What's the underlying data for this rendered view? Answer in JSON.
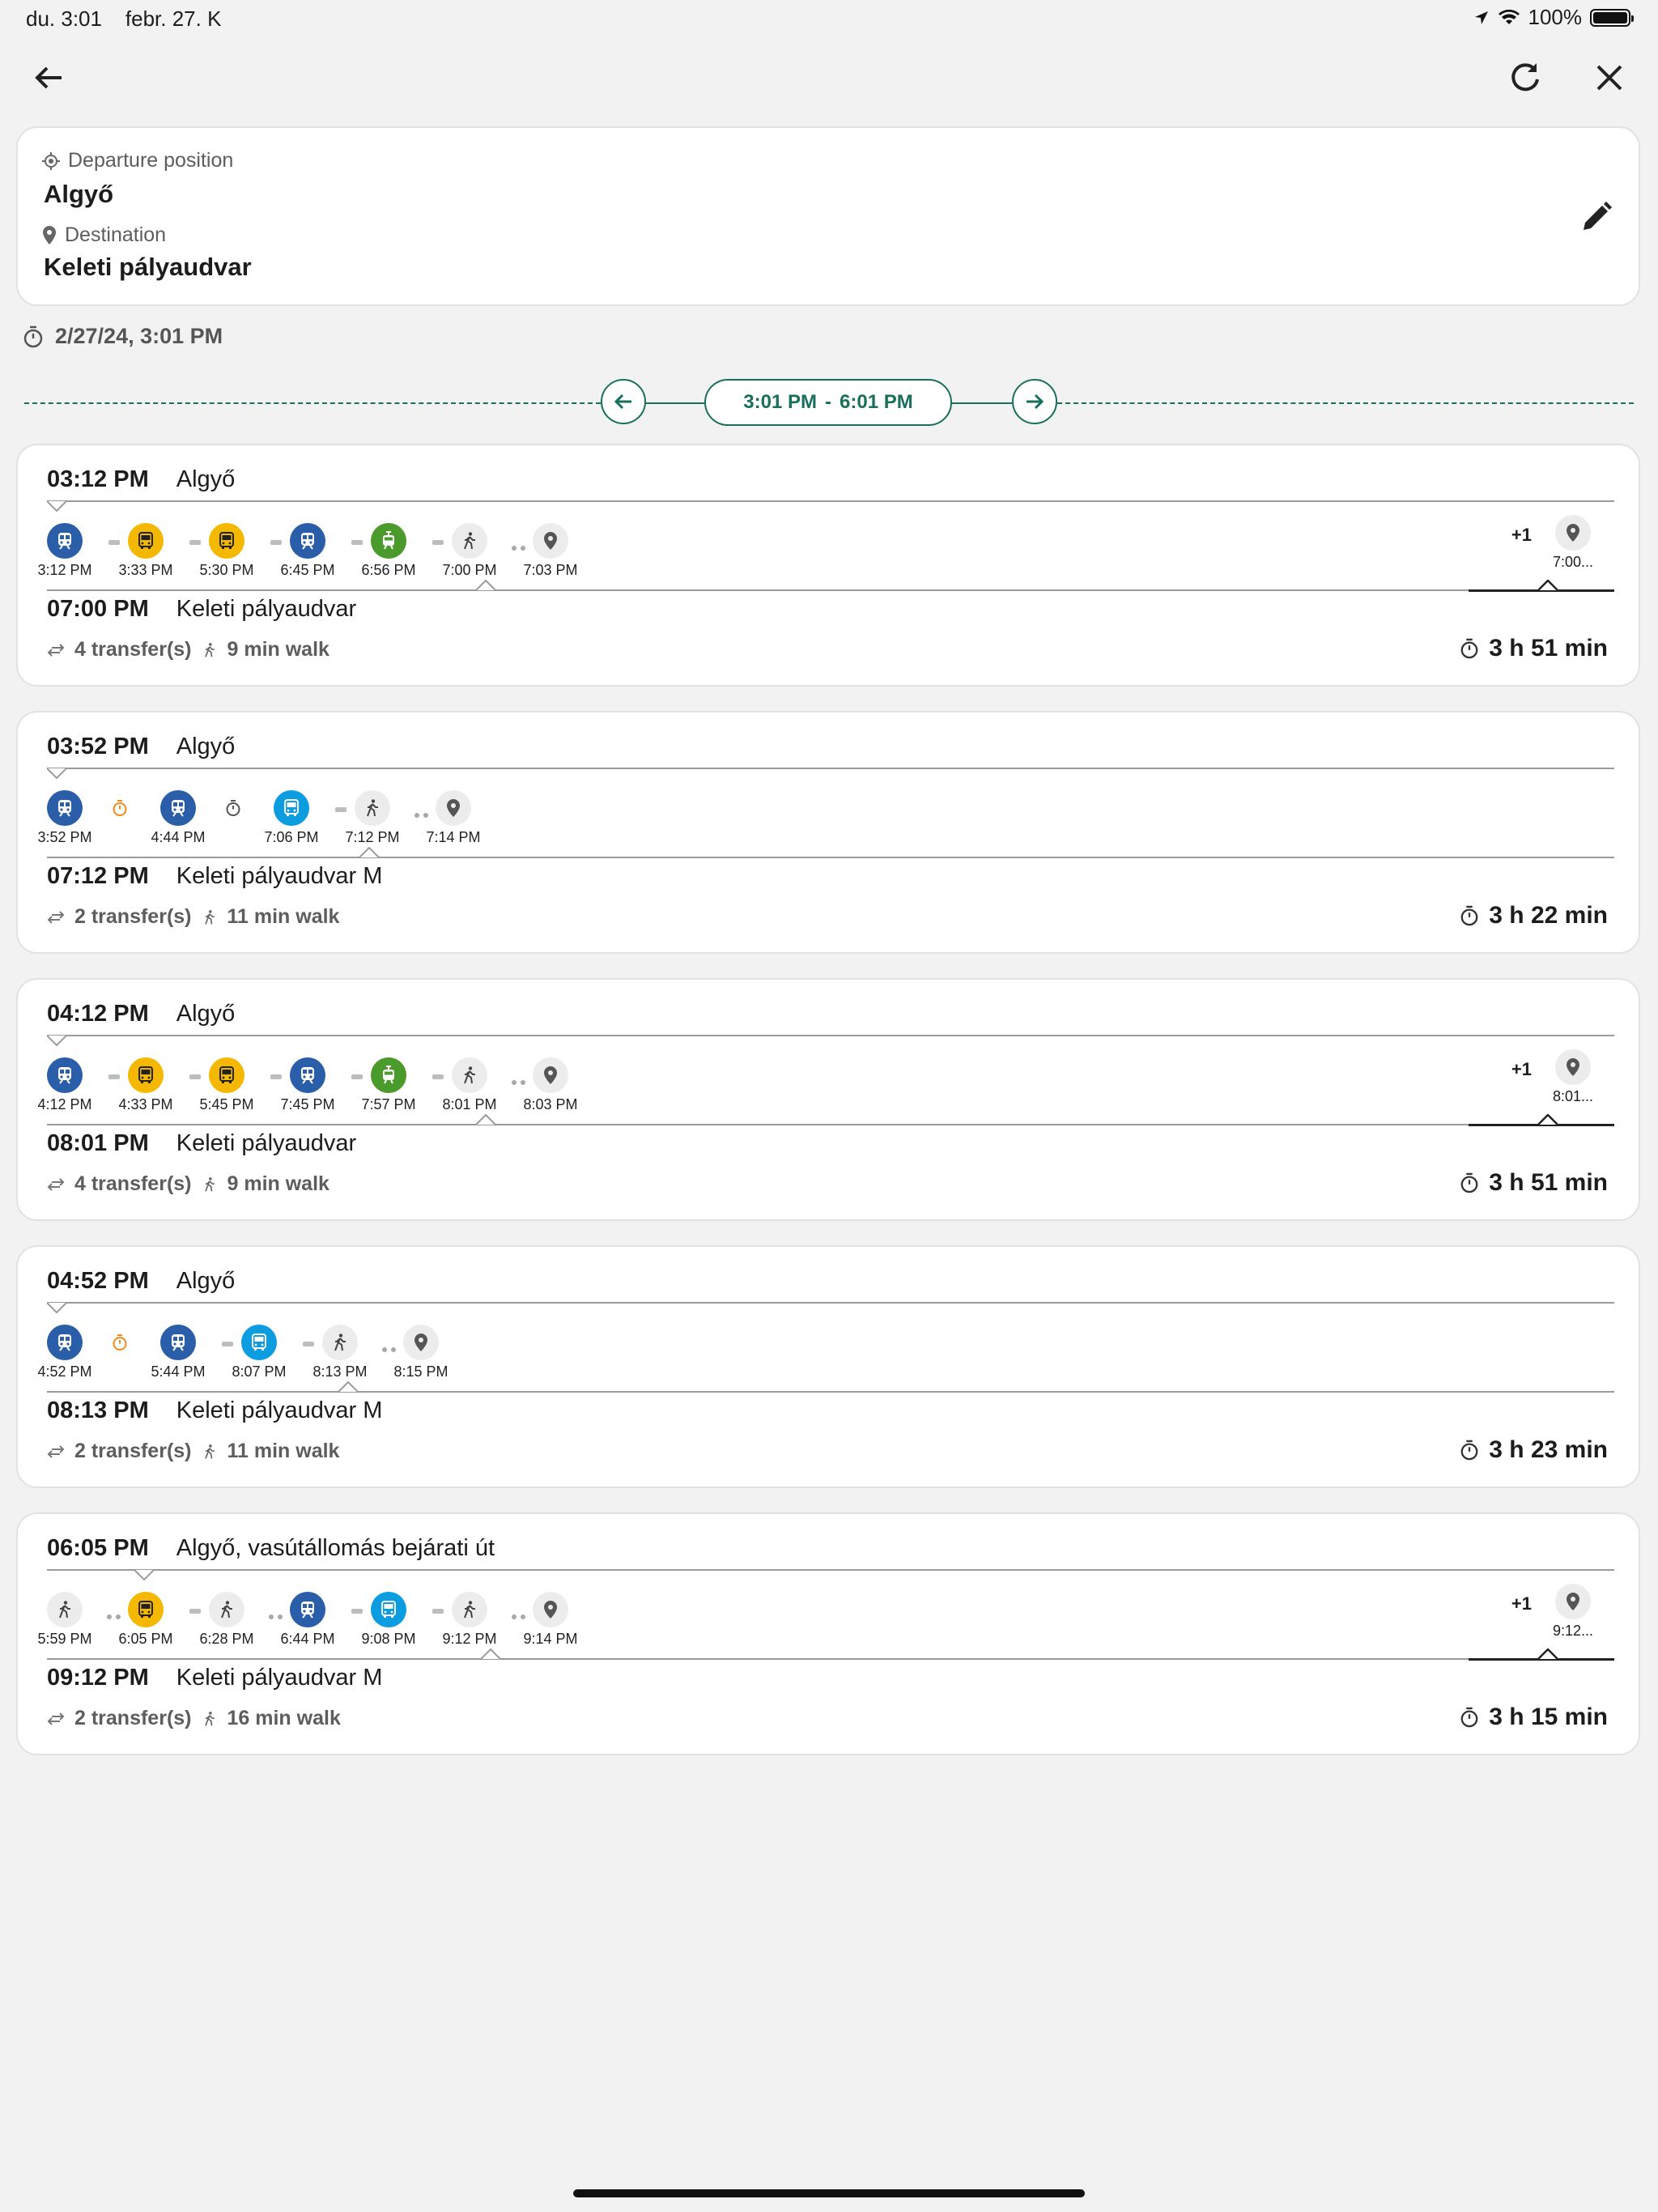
{
  "status": {
    "time": "du. 3:01",
    "date": "febr. 27. K",
    "battery": "100%"
  },
  "header": {
    "back": "back",
    "refresh": "refresh",
    "close": "close"
  },
  "trip": {
    "departure_label": "Departure position",
    "departure": "Algyő",
    "destination_label": "Destination",
    "destination": "Keleti pályaudvar"
  },
  "datetime": "2/27/24, 3:01 PM",
  "range": {
    "from": "3:01 PM",
    "dash": "-",
    "to": "6:01 PM"
  },
  "colors": {
    "accent": "#1a6e5c",
    "train": "#2a5ea8",
    "bus_yellow": "#f5b800",
    "tram_green": "#4a9a2c",
    "bus_blue": "#0c9ce0",
    "walk": "#ececec",
    "transfer_orange": "#f08a1c"
  },
  "routes": [
    {
      "dep_time": "03:12 PM",
      "dep_place": "Algyő",
      "arr_time": "07:00 PM",
      "arr_place": "Keleti pályaudvar",
      "transfers": "4 transfer(s)",
      "walk": "9 min walk",
      "duration": "3 h 51 min",
      "plus": "+1",
      "end_time": "7:00...",
      "legs": [
        {
          "type": "train",
          "time": "3:12 PM"
        },
        {
          "type": "bus_yellow",
          "time": "3:33 PM"
        },
        {
          "type": "bus_yellow",
          "time": "5:30 PM"
        },
        {
          "type": "train",
          "time": "6:45 PM"
        },
        {
          "type": "tram_green",
          "time": "6:56 PM"
        },
        {
          "type": "walk",
          "time": "7:00 PM"
        },
        {
          "type": "pin",
          "time": "7:03 PM"
        }
      ]
    },
    {
      "dep_time": "03:52 PM",
      "dep_place": "Algyő",
      "arr_time": "07:12 PM",
      "arr_place": "Keleti pályaudvar M",
      "transfers": "2 transfer(s)",
      "walk": "11 min walk",
      "duration": "3 h 22 min",
      "plus": "",
      "end_time": "",
      "legs": [
        {
          "type": "train",
          "time": "3:52 PM"
        },
        {
          "type": "wait_orange",
          "time": ""
        },
        {
          "type": "train",
          "time": "4:44 PM"
        },
        {
          "type": "wait_gray",
          "time": ""
        },
        {
          "type": "bus_blue",
          "time": "7:06 PM"
        },
        {
          "type": "walk",
          "time": "7:12 PM"
        },
        {
          "type": "pin",
          "time": "7:14 PM"
        }
      ]
    },
    {
      "dep_time": "04:12 PM",
      "dep_place": "Algyő",
      "arr_time": "08:01 PM",
      "arr_place": "Keleti pályaudvar",
      "transfers": "4 transfer(s)",
      "walk": "9 min walk",
      "duration": "3 h 51 min",
      "plus": "+1",
      "end_time": "8:01...",
      "legs": [
        {
          "type": "train",
          "time": "4:12 PM"
        },
        {
          "type": "bus_yellow",
          "time": "4:33 PM"
        },
        {
          "type": "bus_yellow",
          "time": "5:45 PM"
        },
        {
          "type": "train",
          "time": "7:45 PM"
        },
        {
          "type": "tram_green",
          "time": "7:57 PM"
        },
        {
          "type": "walk",
          "time": "8:01 PM"
        },
        {
          "type": "pin",
          "time": "8:03 PM"
        }
      ]
    },
    {
      "dep_time": "04:52 PM",
      "dep_place": "Algyő",
      "arr_time": "08:13 PM",
      "arr_place": "Keleti pályaudvar M",
      "transfers": "2 transfer(s)",
      "walk": "11 min walk",
      "duration": "3 h 23 min",
      "plus": "",
      "end_time": "",
      "legs": [
        {
          "type": "train",
          "time": "4:52 PM"
        },
        {
          "type": "wait_orange",
          "time": ""
        },
        {
          "type": "train",
          "time": "5:44 PM"
        },
        {
          "type": "bus_blue",
          "time": "8:07 PM"
        },
        {
          "type": "walk",
          "time": "8:13 PM"
        },
        {
          "type": "pin",
          "time": "8:15 PM"
        }
      ]
    },
    {
      "dep_time": "06:05 PM",
      "dep_place": "Algyő, vasútállomás bejárati út",
      "arr_time": "09:12 PM",
      "arr_place": "Keleti pályaudvar M",
      "transfers": "2 transfer(s)",
      "walk": "16 min walk",
      "duration": "3 h 15 min",
      "plus": "+1",
      "end_time": "9:12...",
      "legs": [
        {
          "type": "walk",
          "time": "5:59 PM"
        },
        {
          "type": "bus_yellow",
          "time": "6:05 PM"
        },
        {
          "type": "walk",
          "time": "6:28 PM"
        },
        {
          "type": "train",
          "time": "6:44 PM"
        },
        {
          "type": "bus_blue",
          "time": "9:08 PM"
        },
        {
          "type": "walk",
          "time": "9:12 PM"
        },
        {
          "type": "pin",
          "time": "9:14 PM"
        }
      ]
    }
  ]
}
